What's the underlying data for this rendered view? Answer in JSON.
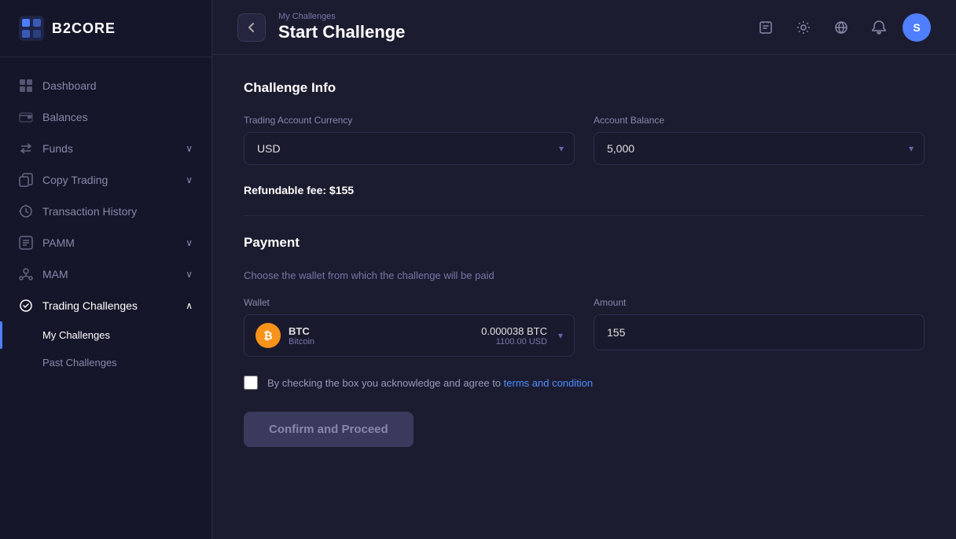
{
  "app": {
    "logo_text": "B2CORE"
  },
  "sidebar": {
    "items": [
      {
        "id": "dashboard",
        "label": "Dashboard",
        "icon": "grid-icon",
        "has_children": false
      },
      {
        "id": "balances",
        "label": "Balances",
        "icon": "wallet-icon",
        "has_children": false
      },
      {
        "id": "funds",
        "label": "Funds",
        "icon": "transfer-icon",
        "has_children": true
      },
      {
        "id": "copy-trading",
        "label": "Copy Trading",
        "icon": "copy-icon",
        "has_children": true
      },
      {
        "id": "transaction-history",
        "label": "Transaction History",
        "icon": "history-icon",
        "has_children": false
      },
      {
        "id": "pamm",
        "label": "PAMM",
        "icon": "pamm-icon",
        "has_children": true
      },
      {
        "id": "mam",
        "label": "MAM",
        "icon": "mam-icon",
        "has_children": true
      },
      {
        "id": "trading-challenges",
        "label": "Trading Challenges",
        "icon": "challenges-icon",
        "has_children": true,
        "active": true
      }
    ],
    "sub_items": [
      {
        "id": "my-challenges",
        "label": "My Challenges",
        "active": true
      },
      {
        "id": "past-challenges",
        "label": "Past Challenges",
        "active": false
      }
    ]
  },
  "topbar": {
    "breadcrumb": "My Challenges",
    "page_title": "Start Challenge",
    "back_label": "‹"
  },
  "content": {
    "challenge_info_title": "Challenge Info",
    "trading_account_currency_label": "Trading Account Currency",
    "trading_account_currency_value": "USD",
    "account_balance_label": "Account Balance",
    "account_balance_value": "5,000",
    "refundable_fee_label": "Refundable fee:",
    "refundable_fee_value": "$155",
    "payment_title": "Payment",
    "payment_desc": "Choose the wallet from which the challenge will be paid",
    "wallet_label": "Wallet",
    "amount_label": "Amount",
    "wallet_name": "BTC",
    "wallet_full_name": "Bitcoin",
    "wallet_balance": "0.000038 BTC",
    "wallet_balance_usd": "1100.00 USD",
    "amount_value": "155",
    "checkbox_label": "By checking the box you acknowledge and agree to ",
    "terms_link_text": "terms and condition",
    "confirm_button_label": "Confirm and Proceed"
  }
}
